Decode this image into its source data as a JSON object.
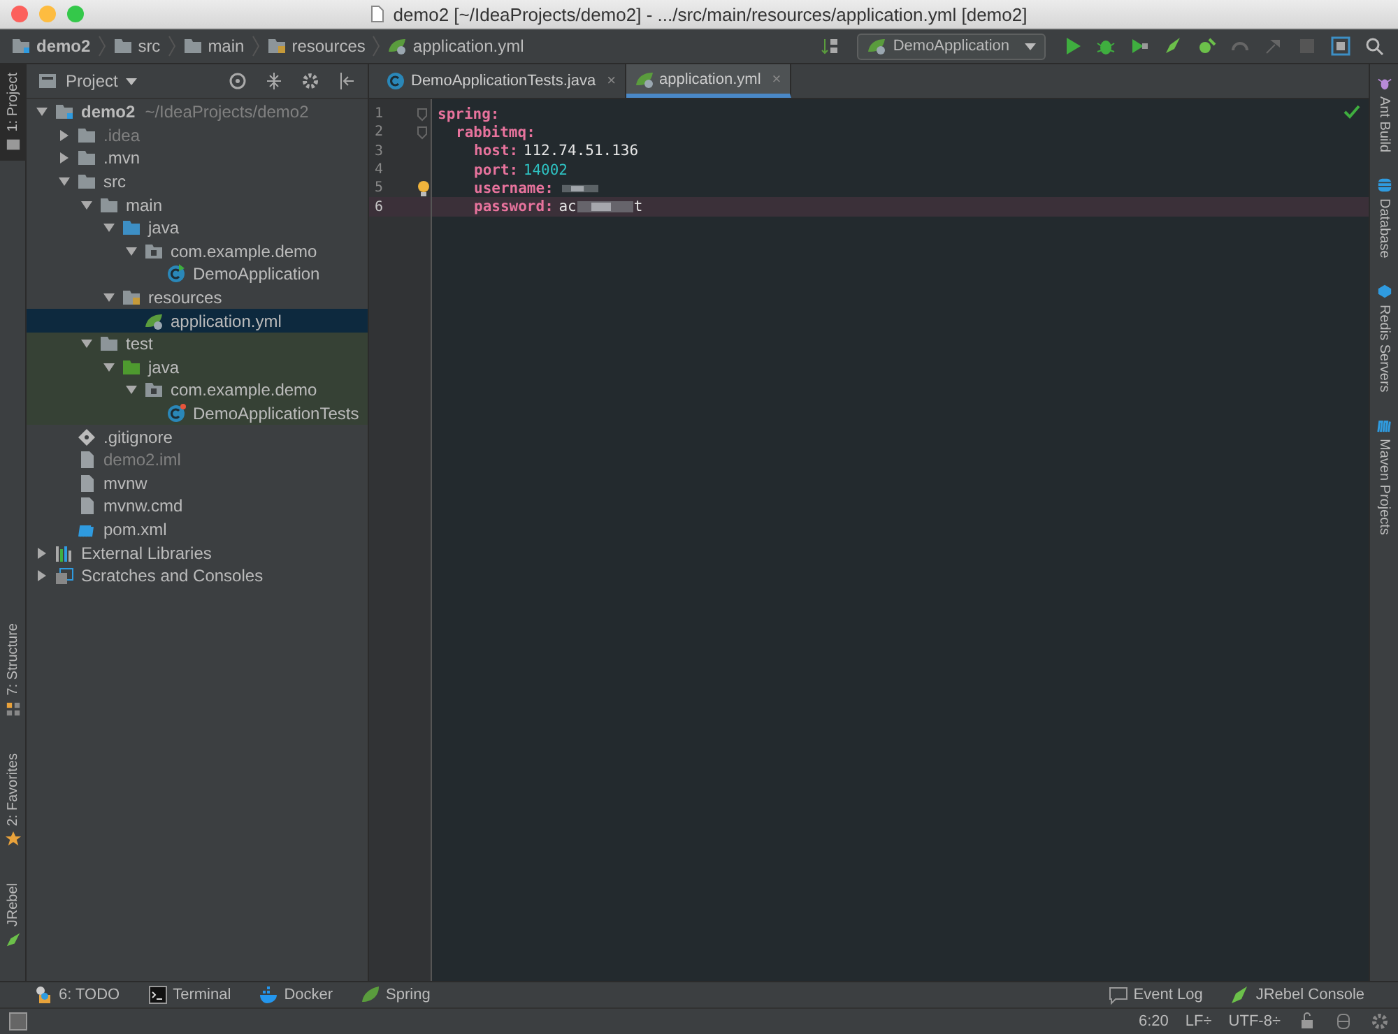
{
  "window": {
    "title": "demo2 [~/IdeaProjects/demo2] - .../src/main/resources/application.yml [demo2]"
  },
  "breadcrumbs": [
    {
      "label": "demo2",
      "kind": "module"
    },
    {
      "label": "src",
      "kind": "folder"
    },
    {
      "label": "main",
      "kind": "folder"
    },
    {
      "label": "resources",
      "kind": "resources"
    },
    {
      "label": "application.yml",
      "kind": "yml"
    }
  ],
  "run_config": {
    "label": "DemoApplication"
  },
  "left_stripe": [
    {
      "label": "1: Project",
      "selected": true,
      "kind": "project"
    },
    {
      "label": "7: Structure",
      "selected": false,
      "kind": "structure"
    },
    {
      "label": "2: Favorites",
      "selected": false,
      "kind": "star"
    },
    {
      "label": "JRebel",
      "selected": false,
      "kind": "jrebel"
    }
  ],
  "project_panel": {
    "title": "Project",
    "tree": [
      {
        "label": "demo2",
        "hint": "~/IdeaProjects/demo2",
        "kind": "module",
        "expanded": true,
        "selected": false,
        "muted": false,
        "test_source": false,
        "children": [
          {
            "label": ".idea",
            "kind": "folder",
            "expanded": false,
            "selected": false,
            "muted": true,
            "test_source": false
          },
          {
            "label": ".mvn",
            "kind": "folder",
            "expanded": false,
            "selected": false,
            "muted": false,
            "test_source": false
          },
          {
            "label": "src",
            "kind": "folder",
            "expanded": true,
            "selected": false,
            "muted": false,
            "test_source": false,
            "children": [
              {
                "label": "main",
                "kind": "folder",
                "expanded": true,
                "selected": false,
                "muted": false,
                "test_source": false,
                "children": [
                  {
                    "label": "java",
                    "kind": "source",
                    "expanded": true,
                    "selected": false,
                    "muted": false,
                    "test_source": false,
                    "children": [
                      {
                        "label": "com.example.demo",
                        "kind": "package",
                        "expanded": true,
                        "selected": false,
                        "muted": false,
                        "test_source": false,
                        "children": [
                          {
                            "label": "DemoApplication",
                            "kind": "spring-class",
                            "selected": false,
                            "muted": false,
                            "test_source": false
                          }
                        ]
                      }
                    ]
                  },
                  {
                    "label": "resources",
                    "kind": "resources",
                    "expanded": true,
                    "selected": false,
                    "muted": false,
                    "test_source": false,
                    "children": [
                      {
                        "label": "application.yml",
                        "kind": "yml",
                        "selected": true,
                        "muted": false
                      }
                    ]
                  }
                ]
              },
              {
                "label": "test",
                "kind": "folder",
                "expanded": true,
                "selected": false,
                "muted": false,
                "test_source": true,
                "children": [
                  {
                    "label": "java",
                    "kind": "test-source",
                    "expanded": true,
                    "selected": false,
                    "muted": false,
                    "test_source": true,
                    "children": [
                      {
                        "label": "com.example.demo",
                        "kind": "package",
                        "expanded": true,
                        "selected": false,
                        "muted": false,
                        "test_source": true,
                        "children": [
                          {
                            "label": "DemoApplicationTests",
                            "kind": "test-class",
                            "selected": false,
                            "muted": false,
                            "test_source": true
                          }
                        ]
                      }
                    ]
                  }
                ]
              }
            ]
          },
          {
            "label": ".gitignore",
            "kind": "git",
            "selected": false,
            "muted": false,
            "test_source": false
          },
          {
            "label": "demo2.iml",
            "kind": "file",
            "selected": false,
            "muted": true,
            "test_source": false
          },
          {
            "label": "mvnw",
            "kind": "file",
            "selected": false,
            "muted": false,
            "test_source": false
          },
          {
            "label": "mvnw.cmd",
            "kind": "file",
            "selected": false,
            "muted": false,
            "test_source": false
          },
          {
            "label": "pom.xml",
            "kind": "maven",
            "selected": false,
            "muted": false,
            "test_source": false
          }
        ]
      },
      {
        "label": "External Libraries",
        "kind": "libraries",
        "expanded": false,
        "selected": false,
        "muted": false,
        "test_source": false
      },
      {
        "label": "Scratches and Consoles",
        "kind": "scratches",
        "expanded": false,
        "selected": false,
        "muted": false,
        "test_source": false
      }
    ]
  },
  "tabs": [
    {
      "label": "DemoApplicationTests.java",
      "kind": "test-class",
      "selected": false,
      "close": "×"
    },
    {
      "label": "application.yml",
      "kind": "yml",
      "selected": true,
      "close": "×"
    }
  ],
  "editor": {
    "entries": [
      {
        "number": "1",
        "key": "spring:",
        "current": false,
        "bulb": false,
        "children": [
          {
            "number": "2",
            "key": "rabbitmq:",
            "current": false,
            "bulb": false,
            "children": [
              {
                "number": "3",
                "key": "host:",
                "value": "112.74.51.136",
                "kind": "text",
                "current": false,
                "bulb": false
              },
              {
                "number": "4",
                "key": "port:",
                "value": "14002",
                "kind": "number",
                "current": false,
                "bulb": false
              },
              {
                "number": "5",
                "key": "username:",
                "kind": "redacted",
                "current": false,
                "bulb": true
              },
              {
                "number": "6",
                "key": "password:",
                "value": "ac",
                "value_tail": "t",
                "kind": "redacted",
                "current": true,
                "bulb": false
              }
            ]
          }
        ]
      }
    ]
  },
  "right_stripe": [
    {
      "label": "Ant Build",
      "kind": "ant"
    },
    {
      "label": "Database",
      "kind": "database"
    },
    {
      "label": "Redis Servers",
      "kind": "redis"
    },
    {
      "label": "Maven Projects",
      "kind": "maven"
    }
  ],
  "bottom_tools_left": [
    {
      "label": "6: TODO",
      "kind": "todo"
    },
    {
      "label": "Terminal",
      "kind": "terminal"
    },
    {
      "label": "Docker",
      "kind": "docker"
    },
    {
      "label": "Spring",
      "kind": "spring"
    }
  ],
  "bottom_tools_right": [
    {
      "label": "Event Log",
      "kind": "log"
    },
    {
      "label": "JRebel Console",
      "kind": "jrebel"
    }
  ],
  "status_bar": {
    "position": "6:20",
    "line_separator": "LF÷",
    "encoding": "UTF-8÷"
  }
}
